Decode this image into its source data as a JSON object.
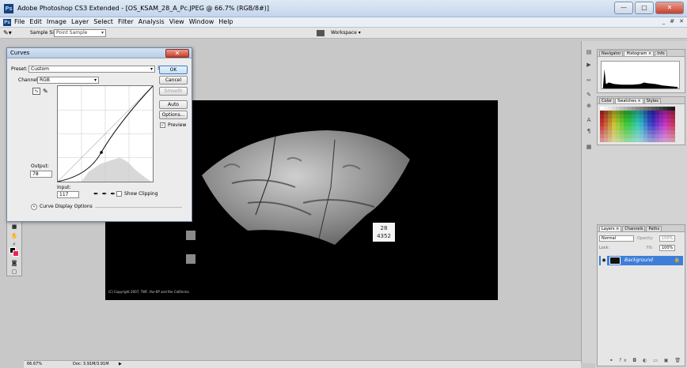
{
  "window": {
    "title": "Adobe Photoshop CS3 Extended - [OS_KSAM_28_A_Pc.JPEG @ 66.7% (RGB/8#)]",
    "app_badge": "Ps",
    "minimize": "—",
    "maximize": "□",
    "close": "✕"
  },
  "menu": {
    "items": [
      "File",
      "Edit",
      "Image",
      "Layer",
      "Select",
      "Filter",
      "Analysis",
      "View",
      "Window",
      "Help"
    ],
    "right_min": "_",
    "right_max": "#",
    "right_close": "✕"
  },
  "options": {
    "sample_size_label": "Sample Size:",
    "sample_size_value": "Point Sample",
    "workspace_label": "Workspace ▾"
  },
  "document": {
    "label_card_line1": "28",
    "label_card_line2": "4352",
    "copyright": "(C) Copyright 2007, TWF, the KP and the California"
  },
  "status": {
    "zoom": "66.67%",
    "doc": "Doc: 3.91M/3.91M",
    "arrow": "▶"
  },
  "curves": {
    "title": "Curves",
    "close": "✕",
    "preset_label": "Preset:",
    "preset_value": "Custom",
    "channel_label": "Channel:",
    "channel_value": "RGB",
    "ok": "OK",
    "cancel": "Cancel",
    "smooth": "Smooth",
    "auto": "Auto",
    "options": "Options...",
    "preview_label": "Preview",
    "output_label": "Output:",
    "output_value": "78",
    "input_label": "Input:",
    "input_value": "117",
    "show_clipping": "Show Clipping",
    "display_options": "Curve Display Options",
    "curve_point": {
      "input": 117,
      "output": 78
    }
  },
  "panels": {
    "top_tabs": [
      "Navigator",
      "Histogram ×",
      "Info"
    ],
    "color_tabs": [
      "Color",
      "Swatches ×",
      "Styles"
    ],
    "layer_tabs": [
      "Layers ×",
      "Channels",
      "Paths"
    ],
    "blend_mode": "Normal",
    "opacity_label": "Opacity:",
    "opacity_value": "100%",
    "lock_label": "Lock:",
    "fill_label": "Fill:",
    "fill_value": "100%",
    "layer_name": "Background"
  },
  "colors": {
    "accent": "#3d7ed9",
    "title_bg": "#c3d5ec",
    "canvas_bg": "#000000"
  }
}
